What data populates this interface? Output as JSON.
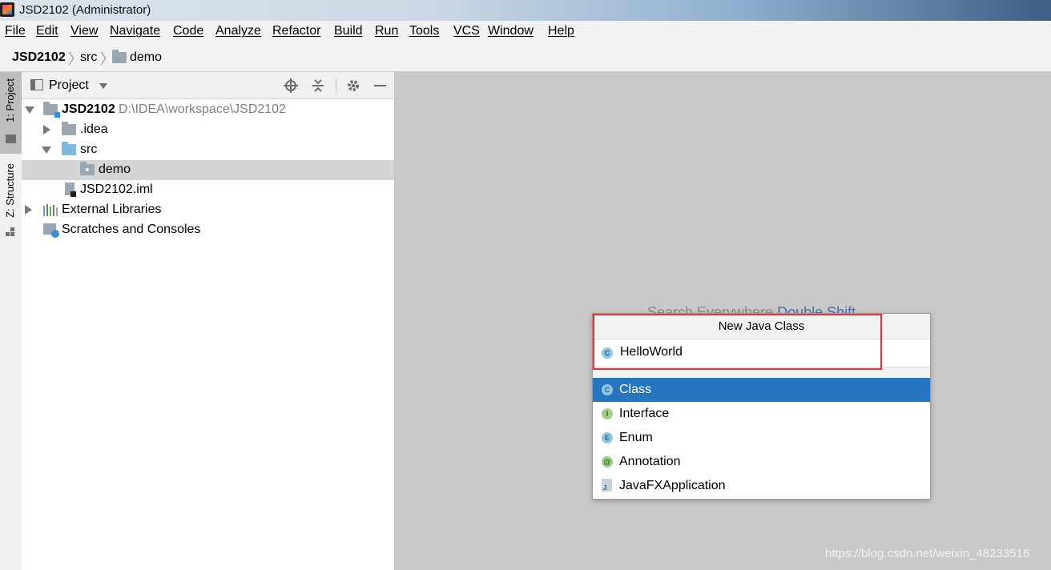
{
  "titlebar": {
    "title": "JSD2102 (Administrator)"
  },
  "menu": [
    "File",
    "Edit",
    "View",
    "Navigate",
    "Code",
    "Analyze",
    "Refactor",
    "Build",
    "Run",
    "Tools",
    "VCS",
    "Window",
    "Help"
  ],
  "breadcrumb": {
    "project": "JSD2102",
    "src": "src",
    "demo": "demo"
  },
  "sidetabs": {
    "project": "1: Project",
    "structure": "Z: Structure"
  },
  "project_panel": {
    "title": "Project",
    "tree": {
      "root": "JSD2102",
      "root_path": "D:\\IDEA\\workspace\\JSD2102",
      "idea": ".idea",
      "src": "src",
      "demo": "demo",
      "iml": "JSD2102.iml",
      "external": "External Libraries",
      "scratches": "Scratches and Consoles"
    }
  },
  "editor": {
    "hint_text": "Search Everywhere",
    "hint_key": "Double Shift"
  },
  "dialog": {
    "title": "New Java Class",
    "name_value": "HelloWorld",
    "kinds": [
      {
        "label": "Class",
        "badge": "C",
        "selected": true
      },
      {
        "label": "Interface",
        "badge": "I",
        "selected": false
      },
      {
        "label": "Enum",
        "badge": "E",
        "selected": false
      },
      {
        "label": "Annotation",
        "badge": "@",
        "selected": false
      },
      {
        "label": "JavaFXApplication",
        "badge": "J",
        "selected": false
      }
    ]
  },
  "watermark": "https://blog.csdn.net/weixin_48233516",
  "colors": {
    "selection": "#2675bf",
    "highlight_box": "#e0353a",
    "folder_blue": "#7fb9dd"
  }
}
